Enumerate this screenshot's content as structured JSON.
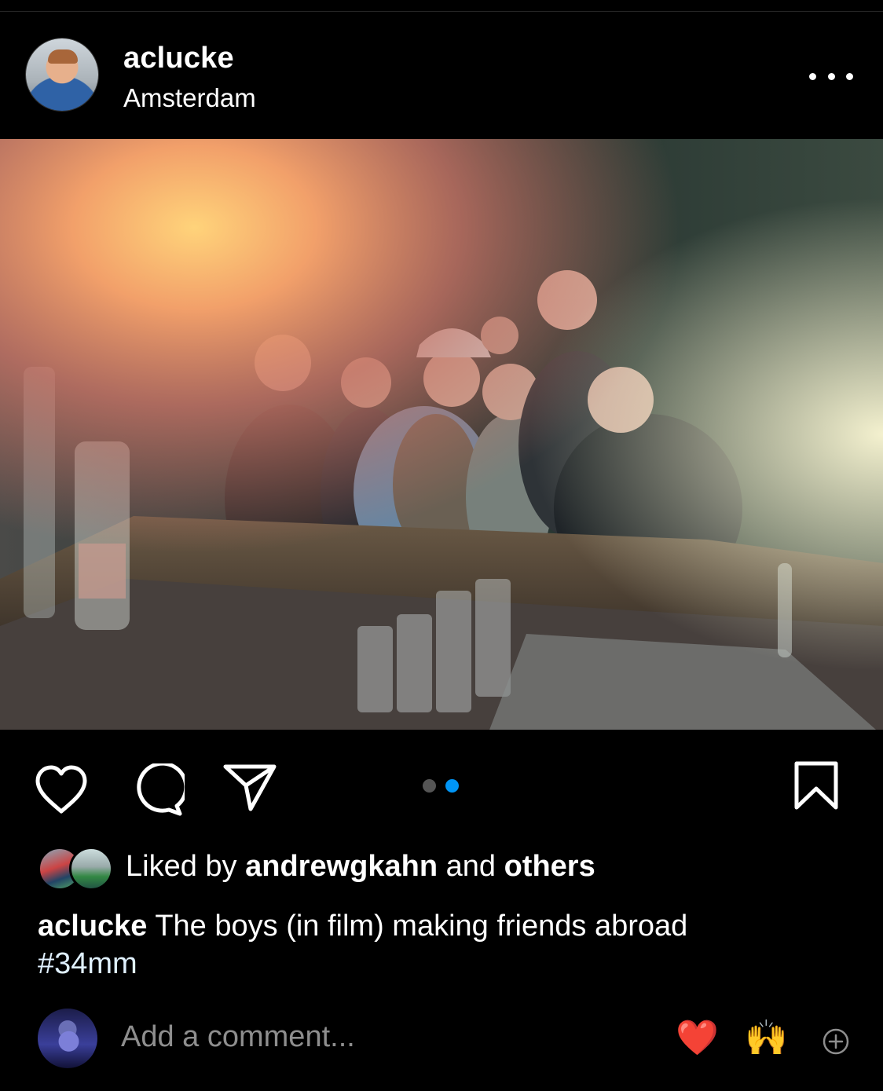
{
  "post": {
    "username": "aclucke",
    "location": "Amsterdam"
  },
  "carousel": {
    "count": 2,
    "active_index": 1
  },
  "likes": {
    "prefix": "Liked by",
    "first_liker": "andrewgkahn",
    "conjunction": "and",
    "others": "others"
  },
  "caption": {
    "username": "aclucke",
    "text": "The boys (in film) making friends abroad",
    "hashtag": "#34mm"
  },
  "comment": {
    "placeholder": "Add a comment...",
    "quick_emojis": [
      "❤️",
      "🙌"
    ]
  },
  "icons": {
    "more": "more-horizontal-icon",
    "like": "heart-icon",
    "comment": "comment-bubble-icon",
    "share": "paper-plane-icon",
    "save": "bookmark-icon",
    "add_emoji": "plus-circle-icon"
  },
  "colors": {
    "background": "#000000",
    "text": "#ffffff",
    "muted": "#8e8e8e",
    "carousel_active": "#0095f6",
    "carousel_inactive": "#555555"
  }
}
